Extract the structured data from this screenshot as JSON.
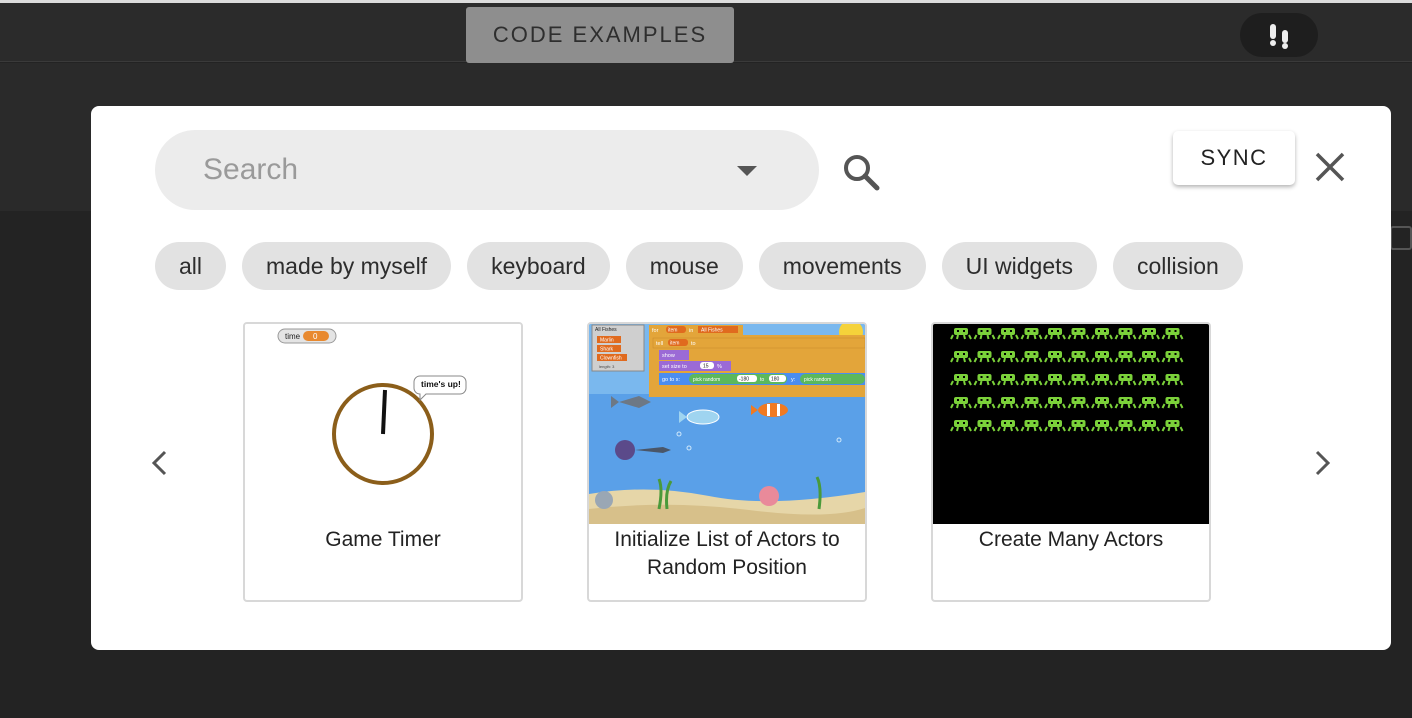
{
  "header": {
    "code_examples_label": "CODE EXAMPLES"
  },
  "search": {
    "placeholder": "Search"
  },
  "modal": {
    "sync_label": "SYNC"
  },
  "tags": [
    "all",
    "made by myself",
    "keyboard",
    "mouse",
    "movements",
    "UI widgets",
    "collision"
  ],
  "cards": [
    {
      "title": "Game Timer",
      "thumb_text": {
        "time_label": "time",
        "time_value": "0",
        "bubble": "time's up!"
      }
    },
    {
      "title": "Initialize List of Actors to Random Position",
      "thumb_text": {
        "list_title": "All Fishes",
        "list_items": [
          "Marlin",
          "Shark",
          "Clownfish"
        ],
        "list_length": "length: 3",
        "block_for": "for",
        "block_item": "item",
        "block_in": "in",
        "block_list": "All Fishes",
        "block_tell": "tell",
        "block_to": "to",
        "block_show": "show",
        "block_set_size": "set size to",
        "block_size_value": "15",
        "block_pct": "%",
        "block_goto": "go to x:",
        "block_pick": "pick random",
        "block_min": "-180",
        "block_to2": "to",
        "block_max": "180",
        "block_y": "y:",
        "block_pick2": "pick random"
      }
    },
    {
      "title": "Create Many Actors"
    }
  ],
  "icons": {
    "search": "search-icon",
    "close": "close-icon",
    "dropdown": "chevron-down-icon",
    "prev": "chevron-left-icon",
    "next": "chevron-right-icon",
    "steps": "footsteps-icon"
  },
  "colors": {
    "backdrop": "#232323",
    "timer_ring": "#8b5e1a",
    "invader": "#7bd13a",
    "water": "#5aa0e8"
  }
}
